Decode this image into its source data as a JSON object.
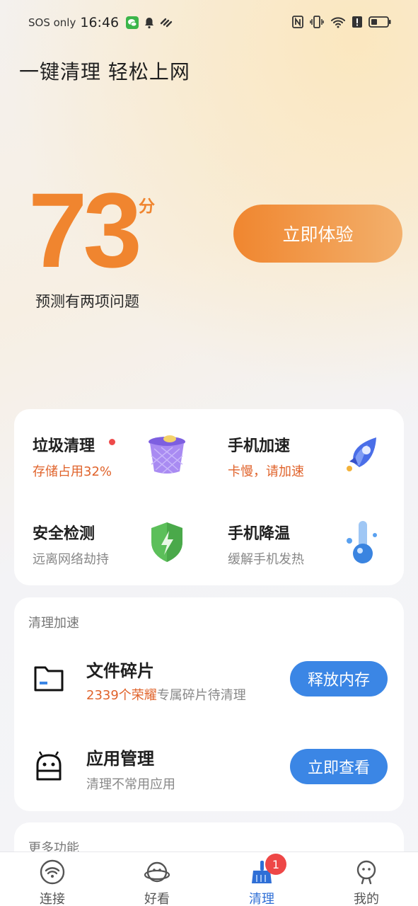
{
  "status_bar": {
    "carrier": "SOS only",
    "time": "16:46"
  },
  "headline": "一键清理 轻松上网",
  "score": {
    "value": "73",
    "unit": "分",
    "description": "预测有两项问题",
    "action_label": "立即体验",
    "accent": "#f0852f"
  },
  "features": [
    {
      "title": "垃圾清理",
      "subtitle": "存储占用32%",
      "icon": "trash-bin-icon",
      "has_dot": true
    },
    {
      "title": "手机加速",
      "subtitle": "卡慢，请加速",
      "icon": "rocket-icon",
      "has_dot": false
    },
    {
      "title": "安全检测",
      "subtitle": "远离网络劫持",
      "icon": "shield-icon",
      "has_dot": false
    },
    {
      "title": "手机降温",
      "subtitle": "缓解手机发热",
      "icon": "thermometer-icon",
      "has_dot": false
    }
  ],
  "clean_section": {
    "title": "清理加速",
    "rows": [
      {
        "title": "文件碎片",
        "subtitle_highlight": "2339个荣耀",
        "subtitle_rest": "专属碎片待清理",
        "button": "释放内存",
        "icon": "folder-icon"
      },
      {
        "title": "应用管理",
        "subtitle_rest": "清理不常用应用",
        "button": "立即查看",
        "icon": "android-app-icon"
      }
    ]
  },
  "more_section": {
    "title": "更多功能"
  },
  "tabs": [
    {
      "label": "连接",
      "icon": "wifi-icon",
      "active": false
    },
    {
      "label": "好看",
      "icon": "planet-face-icon",
      "active": false
    },
    {
      "label": "清理",
      "icon": "broom-icon",
      "active": true,
      "badge": "1"
    },
    {
      "label": "我的",
      "icon": "profile-face-icon",
      "active": false
    }
  ],
  "colors": {
    "primary_blue": "#3b86e5",
    "warning_orange": "#e0632b",
    "badge_red": "#ee4747"
  }
}
